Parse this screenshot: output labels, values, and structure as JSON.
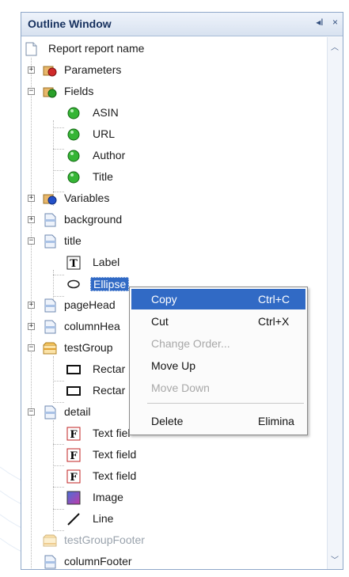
{
  "window": {
    "title": "Outline Window",
    "pin_icon": "pin-icon",
    "close_icon": "close-icon",
    "close_glyph": "×",
    "pin_glyph": "◂I"
  },
  "tree": {
    "report": "Report report name",
    "parameters": "Parameters",
    "fields": "Fields",
    "field_items": [
      "ASIN",
      "URL",
      "Author",
      "Title"
    ],
    "variables": "Variables",
    "background": "background",
    "title_band": "title",
    "label": "Label",
    "ellipse": "Ellipse",
    "page_header": "pageHead",
    "column_header": "columnHea",
    "test_group": "testGroup",
    "rect1": "Rectar",
    "rect2": "Rectar",
    "detail": "detail",
    "text_fields": [
      "Text fiel",
      "Text field",
      "Text field"
    ],
    "image": "Image",
    "line": "Line",
    "test_group_footer": "testGroupFooter",
    "column_footer": "columnFooter"
  },
  "context_menu": {
    "items": [
      {
        "label": "Copy",
        "shortcut": "Ctrl+C"
      },
      {
        "label": "Cut",
        "shortcut": "Ctrl+X"
      },
      {
        "label": "Change Order...",
        "shortcut": ""
      },
      {
        "label": "Move Up",
        "shortcut": ""
      },
      {
        "label": "Move Down",
        "shortcut": ""
      },
      {
        "label": "Delete",
        "shortcut": "Elimina"
      }
    ]
  },
  "colors": {
    "selection": "#316ac5",
    "field_green": "#2aa02a",
    "title_text": "#16305e"
  }
}
